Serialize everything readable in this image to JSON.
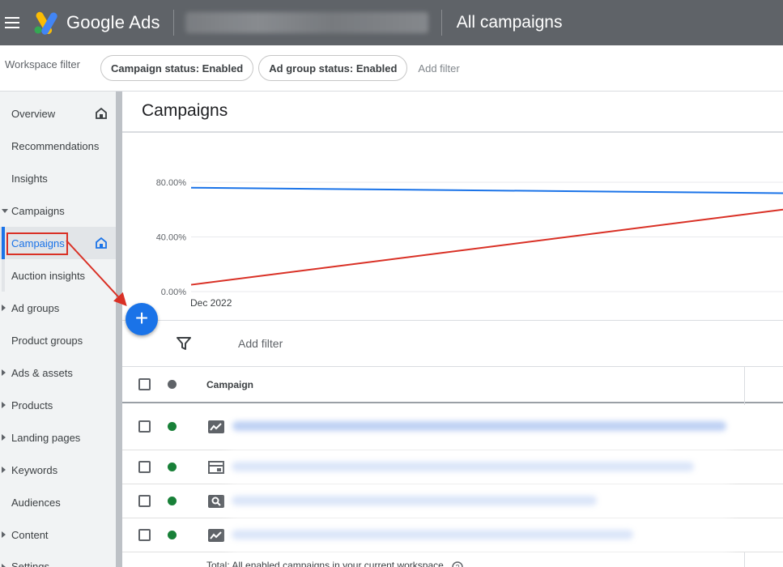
{
  "topbar": {
    "brand": "Google Ads",
    "page_title": "All campaigns",
    "menu_icon": "menu-icon"
  },
  "filters": {
    "workspace_label": "Workspace filter",
    "chips": [
      "Campaign status: Enabled",
      "Ad group status: Enabled"
    ],
    "add_filter": "Add filter"
  },
  "sidebar": {
    "items": [
      {
        "label": "Overview",
        "icon": "home-icon"
      },
      {
        "label": "Recommendations"
      },
      {
        "label": "Insights"
      },
      {
        "label": "Campaigns",
        "expanded": true
      },
      {
        "label": "Campaigns",
        "active": true,
        "icon": "home-icon"
      },
      {
        "label": "Auction insights"
      },
      {
        "label": "Ad groups",
        "collapsible": true
      },
      {
        "label": "Product groups"
      },
      {
        "label": "Ads & assets",
        "collapsible": true
      },
      {
        "label": "Products",
        "collapsible": true
      },
      {
        "label": "Landing pages",
        "collapsible": true
      },
      {
        "label": "Keywords",
        "collapsible": true
      },
      {
        "label": "Audiences"
      },
      {
        "label": "Content",
        "collapsible": true
      },
      {
        "label": "Settings",
        "collapsible": true
      }
    ]
  },
  "main": {
    "title": "Campaigns",
    "add_filter": "Add filter",
    "table": {
      "header": "Campaign",
      "rows": [
        {
          "status": "enabled",
          "type_icon": "performance-max-icon"
        },
        {
          "status": "enabled",
          "type_icon": "display-icon"
        },
        {
          "status": "enabled",
          "type_icon": "search-icon"
        },
        {
          "status": "enabled",
          "type_icon": "performance-max-icon"
        }
      ],
      "footer": "Total: All enabled campaigns in your current workspace"
    }
  },
  "chart_data": {
    "type": "line",
    "x": [
      "Dec 2022"
    ],
    "yticks": [
      "0.00%",
      "40.00%",
      "80.00%"
    ],
    "ylim": [
      0,
      120
    ],
    "xlabel": "",
    "ylabel": "",
    "series": [
      {
        "color": "#1a73e8",
        "values": [
          76,
          72
        ]
      },
      {
        "color": "#d93025",
        "values": [
          5,
          60
        ]
      }
    ]
  },
  "colors": {
    "accent": "#1a73e8",
    "topbar": "#5f6368",
    "status_enabled": "#188038",
    "annotation": "#d93025"
  }
}
